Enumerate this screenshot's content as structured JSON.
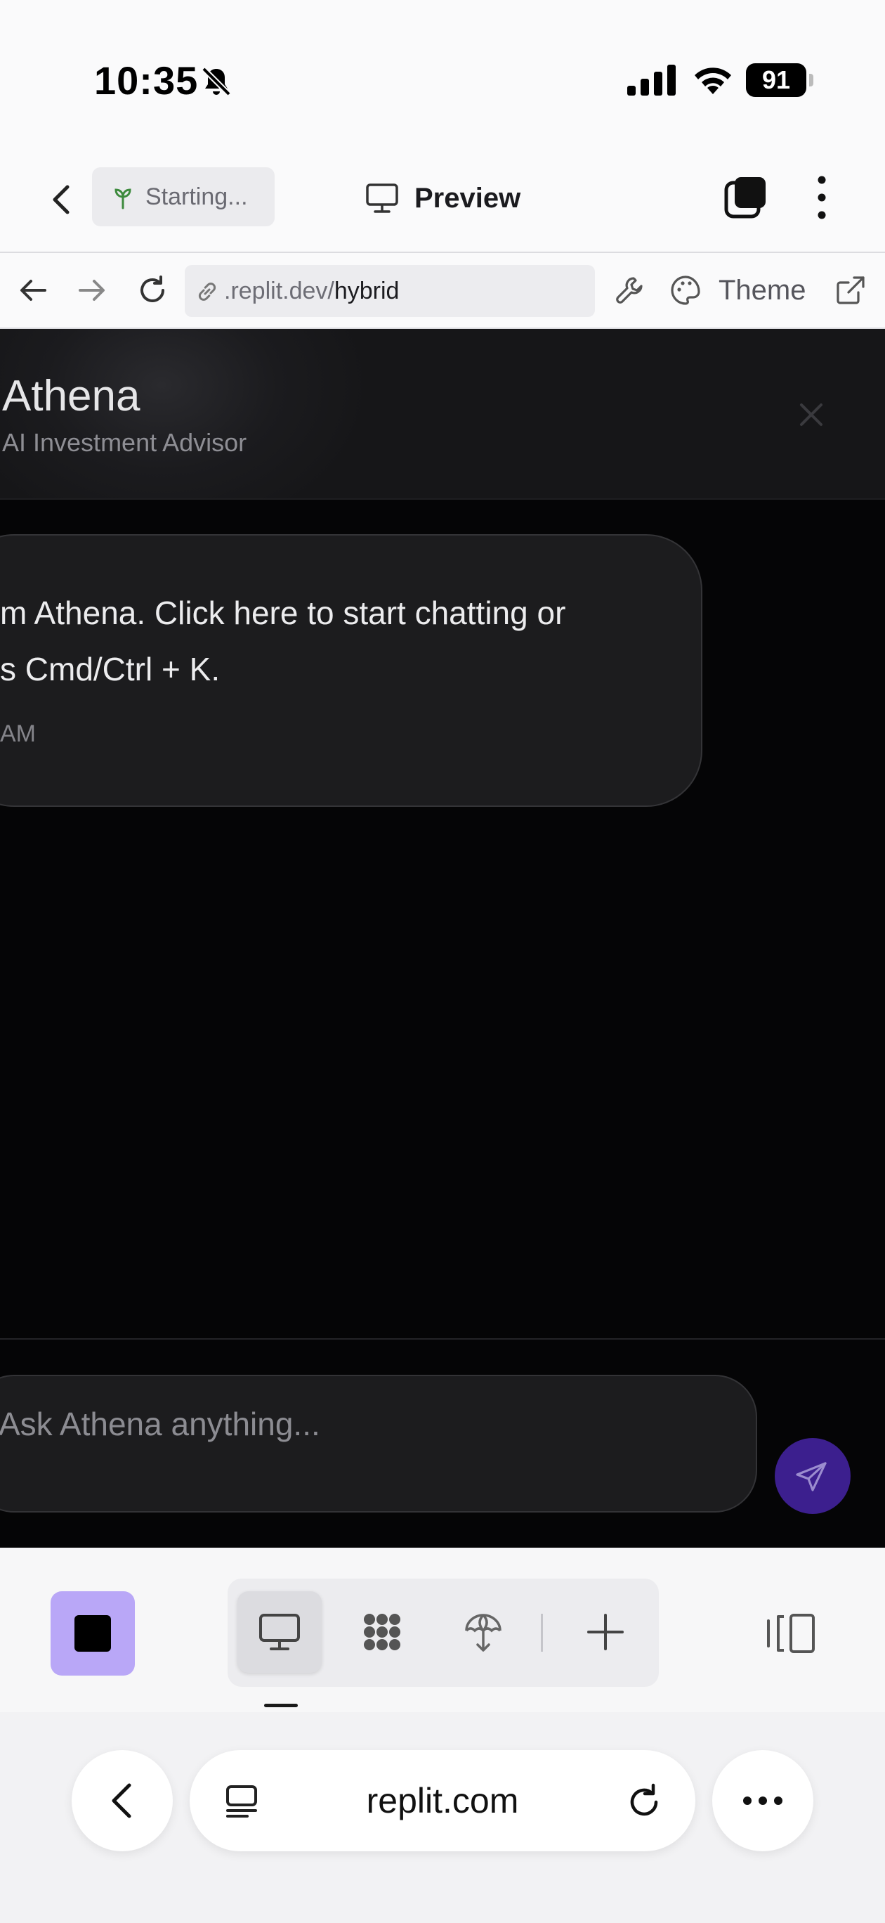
{
  "status_bar": {
    "time": "10:35",
    "battery": "91",
    "icons": [
      "bell-slash-icon",
      "cellular-signal-icon",
      "wifi-icon",
      "battery-icon"
    ]
  },
  "header": {
    "status_pill": "Starting...",
    "title": "Preview",
    "icons": [
      "chevron-left-icon",
      "sprout-icon",
      "monitor-icon",
      "tabs-icon",
      "kebab-icon"
    ]
  },
  "url_toolbar": {
    "url_prefix": ".replit.dev/",
    "url_path": "hybrid",
    "theme_label": "Theme",
    "icons": [
      "arrow-left-icon",
      "arrow-right-icon",
      "reload-icon",
      "link-icon",
      "wrench-icon",
      "palette-icon",
      "external-link-icon"
    ]
  },
  "app": {
    "title": "Athena",
    "subtitle": "AI Investment Advisor",
    "message": {
      "line1": "m Athena. Click here to start chatting or",
      "line2": "s Cmd/Ctrl + K.",
      "time": "AM"
    },
    "input_placeholder": "Ask Athena anything...",
    "colors": {
      "background": "#050506",
      "send_button": "#3c1f8e",
      "bubble": "#1c1c1e"
    }
  },
  "dock": {
    "stop_color": "#b9a7f7",
    "segments": [
      "monitor-icon",
      "workflow-icon",
      "deploy-icon",
      "plus-icon"
    ],
    "active_segment": "monitor-icon"
  },
  "safari": {
    "domain": "replit.com"
  }
}
